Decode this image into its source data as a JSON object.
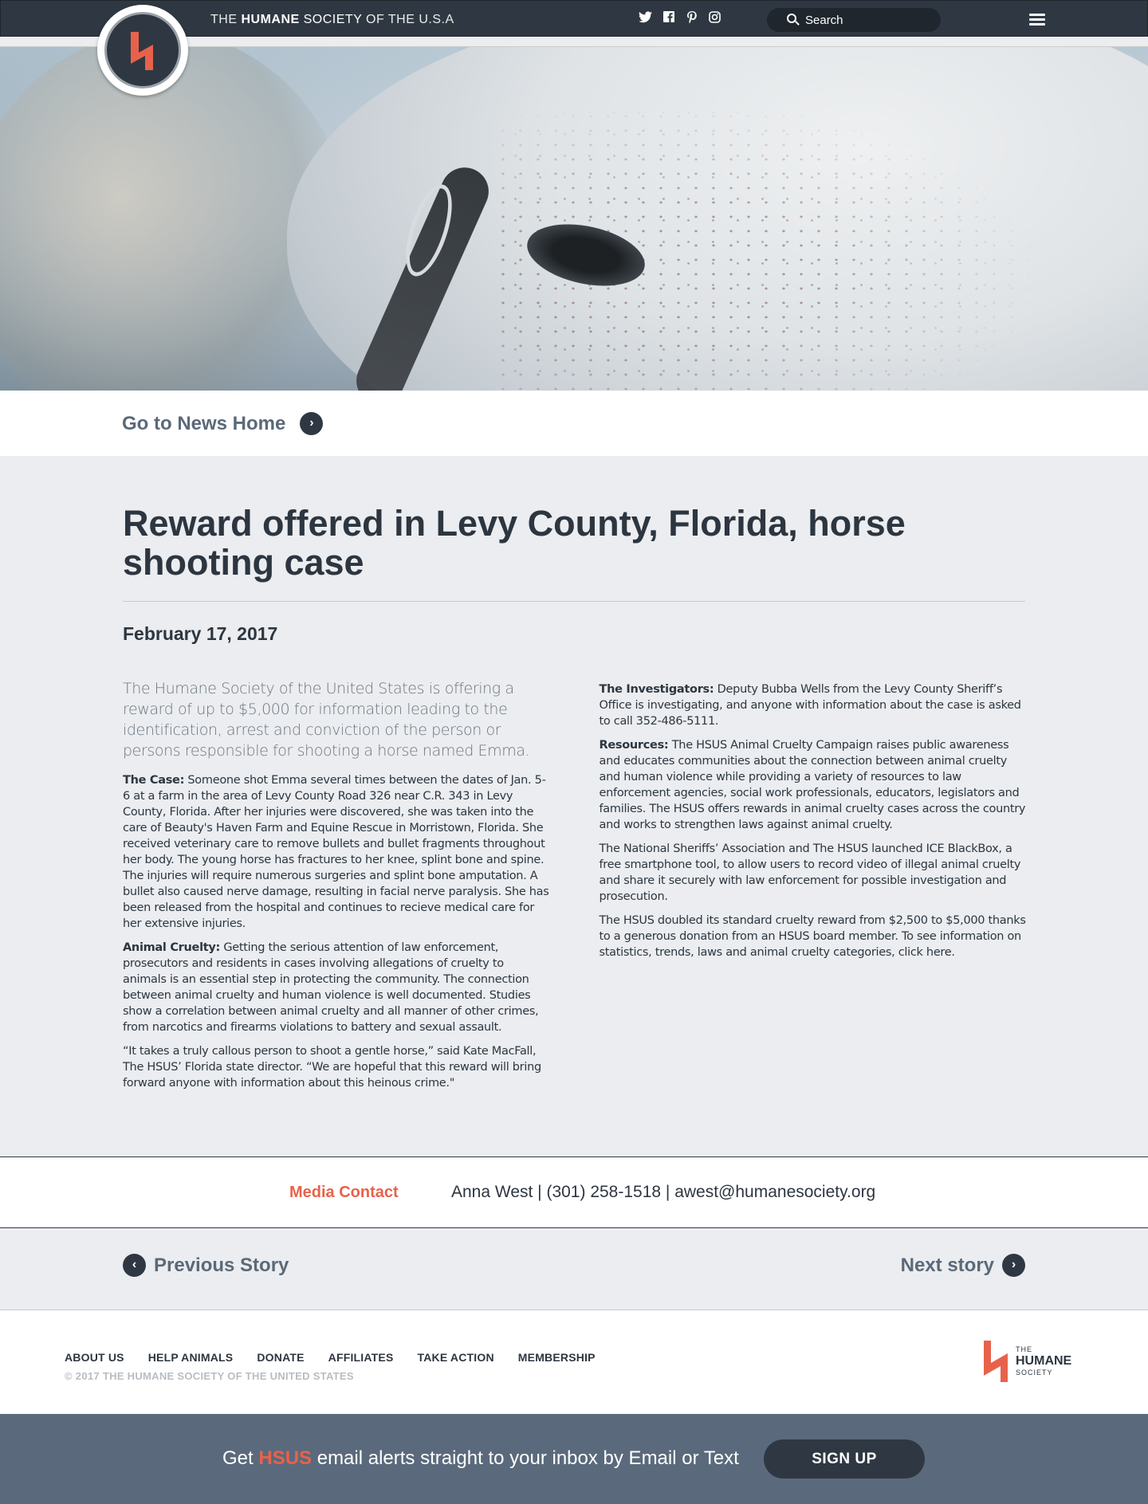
{
  "header": {
    "brand_prefix": "THE",
    "brand_strong": "HUMANE",
    "brand_mid": "SOCIETY",
    "brand_suffix": "OF THE U.S.A",
    "social_icons": [
      "twitter-icon",
      "facebook-icon",
      "pinterest-icon",
      "instagram-icon"
    ],
    "search_placeholder": "Search",
    "colors": {
      "bar": "#2f3842",
      "accent": "#e8624b"
    }
  },
  "nav_back": {
    "label": "Go to News Home"
  },
  "article": {
    "title": "Reward offered in Levy County, Florida, horse shooting case",
    "date": "February 17, 2017",
    "lead": "The Humane Society of the United States is offering a reward of up to $5,000 for information leading to the identification, arrest and conviction of the person or persons responsible for shooting a horse named Emma.",
    "left": [
      {
        "head": "The Case:",
        "text": " Someone shot Emma several times between the dates of Jan. 5-6 at a farm in the area of Levy County Road 326 near C.R. 343 in Levy County, Florida. After her injuries were discovered, she was taken into the care of Beauty's Haven Farm and Equine Rescue in Morristown, Florida. She received veterinary care to remove bullets and bullet fragments throughout her body. The young horse has fractures to her knee, splint bone and spine. The injuries will require numerous surgeries and splint bone amputation. A bullet also caused nerve damage, resulting in facial nerve paralysis. She has been released from the hospital and continues to recieve medical care for her extensive injuries."
      },
      {
        "head": "Animal Cruelty:",
        "text": " Getting the serious attention of law enforcement, prosecutors and residents in cases involving allegations of cruelty to animals is an essential step in protecting the community. The connection between animal cruelty and human violence is well documented. Studies show a correlation between animal cruelty and all manner of other crimes, from narcotics and firearms violations to battery and sexual assault."
      },
      {
        "head": "",
        "text": "“It takes a truly callous person to shoot a gentle horse,” said Kate MacFall, The HSUS’ Florida state director. “We are hopeful that this reward will bring forward anyone with information about this heinous crime.\""
      }
    ],
    "right": [
      {
        "head": "The Investigators:",
        "text": " Deputy Bubba Wells from the Levy County Sheriff’s Office is investigating, and anyone with information about the case is asked to call 352-486-5111."
      },
      {
        "head": "Resources:",
        "text": " The HSUS Animal Cruelty Campaign raises public awareness and educates communities about the connection between animal cruelty and human violence while providing a variety of resources to law enforcement agencies, social work professionals, educators, legislators and families. The HSUS offers rewards in animal cruelty cases across the country and works to strengthen laws against animal cruelty."
      },
      {
        "head": "",
        "text": "The National Sheriffs’ Association and The HSUS launched ICE BlackBox, a free smartphone tool, to allow users to record video of illegal animal cruelty and share it securely with law enforcement for possible investigation and prosecution."
      },
      {
        "head": "",
        "text": "The HSUS doubled its standard cruelty reward from $2,500 to $5,000 thanks to a generous donation from an HSUS board member. To see information on statistics, trends, laws and animal cruelty categories, click here."
      }
    ]
  },
  "media_contact": {
    "label": "Media Contact",
    "info": "Anna West | (301) 258-1518 | awest@humanesociety.org"
  },
  "story_nav": {
    "prev": "Previous Story",
    "next": "Next story"
  },
  "footer": {
    "links": [
      "ABOUT US",
      "HELP ANIMALS",
      "DONATE",
      "AFFILIATES",
      "TAKE ACTION",
      "MEMBERSHIP"
    ],
    "copyright": "© 2017 THE HUMANE SOCIETY OF THE UNITED STATES",
    "logo_line1": "THE",
    "logo_line2": "HUMANE",
    "logo_line3": "SOCIETY"
  },
  "signup": {
    "pre": "Get ",
    "highlight": "HSUS",
    "post": " email alerts straight to your inbox by Email or Text",
    "button": "SIGN UP"
  }
}
